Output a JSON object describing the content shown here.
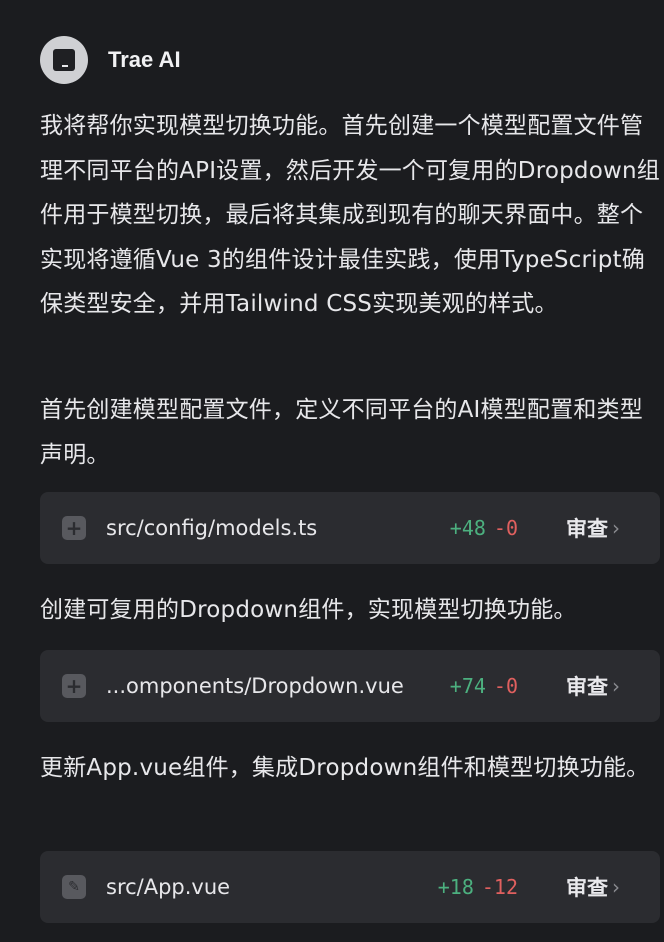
{
  "header": {
    "name": "Trae AI",
    "avatar_icon": "trae-logo-icon"
  },
  "messages": [
    "我将帮你实现模型切换功能。首先创建一个模型配置文件管理不同平台的API设置，然后开发一个可复用的Dropdown组件用于模型切换，最后将其集成到现有的聊天界面中。整个实现将遵循Vue 3的组件设计最佳实践，使用TypeScript确保类型安全，并用Tailwind CSS实现美观的样式。",
    "首先创建模型配置文件，定义不同平台的AI模型配置和类型声明。",
    "创建可复用的Dropdown组件，实现模型切换功能。",
    "更新App.vue组件，集成Dropdown组件和模型切换功能。"
  ],
  "files": [
    {
      "icon": "plus-square-icon",
      "name": "src/config/models.ts",
      "added": "+48",
      "removed": "-0",
      "review": "审查"
    },
    {
      "icon": "plus-square-icon",
      "name": "...omponents/Dropdown.vue",
      "added": "+74",
      "removed": "-0",
      "review": "审查"
    },
    {
      "icon": "pencil-icon",
      "name": "src/App.vue",
      "added": "+18",
      "removed": "-12",
      "review": "审查"
    }
  ],
  "colors": {
    "background": "#1b1c1f",
    "card": "#2b2c30",
    "added": "#4cb07f",
    "removed": "#e0605f"
  }
}
